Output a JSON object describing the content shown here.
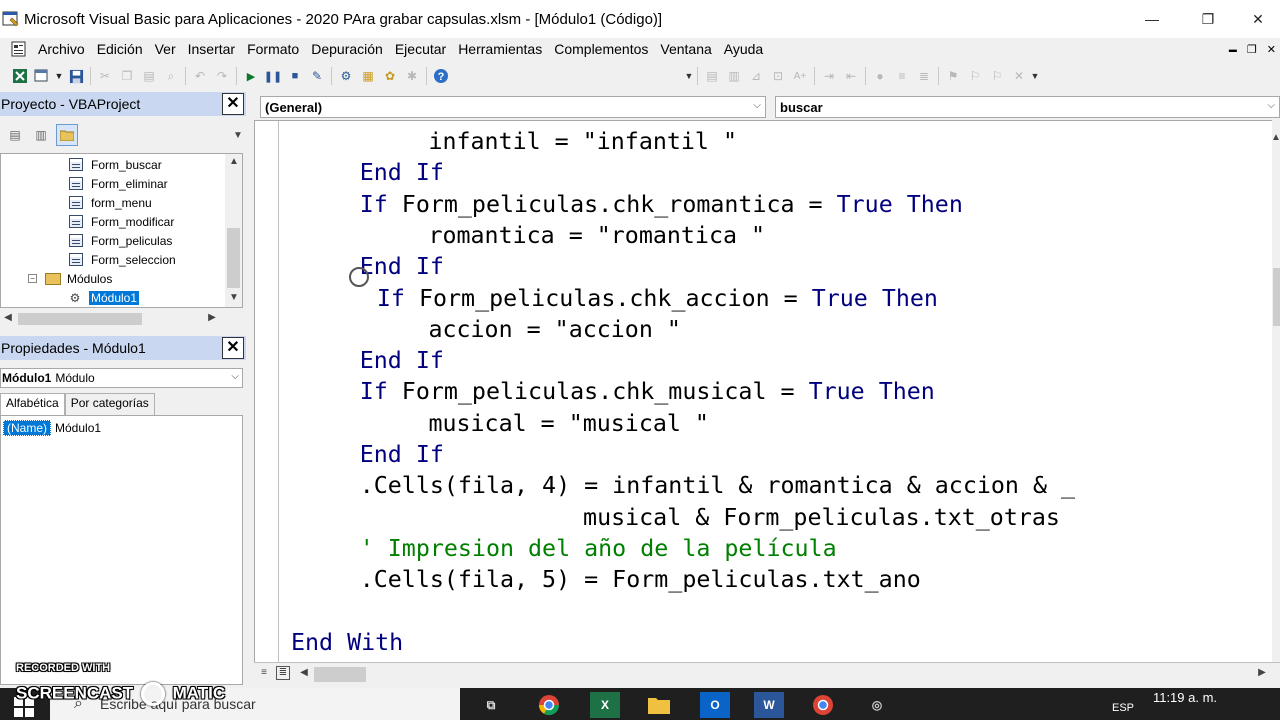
{
  "window": {
    "title": "Microsoft Visual Basic para Aplicaciones - 2020 PAra grabar capsulas.xlsm - [Módulo1 (Código)]",
    "minimize_glyph": "—",
    "restore_glyph": "❐",
    "close_glyph": "✕"
  },
  "menu": {
    "items": [
      "Archivo",
      "Edición",
      "Ver",
      "Insertar",
      "Formato",
      "Depuración",
      "Ejecutar",
      "Herramientas",
      "Complementos",
      "Ventana",
      "Ayuda"
    ],
    "mdi_minimize": "▬",
    "mdi_restore": "❐",
    "mdi_close": "✕"
  },
  "project_pane": {
    "title": "Proyecto - VBAProject",
    "items": [
      {
        "label": "Form_buscar",
        "icon": "form-icon"
      },
      {
        "label": "Form_eliminar",
        "icon": "form-icon"
      },
      {
        "label": "form_menu",
        "icon": "form-icon"
      },
      {
        "label": "Form_modificar",
        "icon": "form-icon"
      },
      {
        "label": "Form_peliculas",
        "icon": "form-icon"
      },
      {
        "label": "Form_seleccion",
        "icon": "form-icon"
      }
    ],
    "modules_folder": "Módulos",
    "selected_module": "Módulo1"
  },
  "properties_pane": {
    "title": "Propiedades - Módulo1",
    "object_name": "Módulo1",
    "object_type": "Módulo",
    "tabs": [
      "Alfabética",
      "Por categorías"
    ],
    "property_name": "(Name)",
    "property_value": "Módulo1"
  },
  "code_window": {
    "object_combo": "(General)",
    "procedure_combo": "buscar",
    "lines": [
      {
        "indent": 8,
        "parts": [
          {
            "t": "infantil = \"infantil \"",
            "c": "plain"
          }
        ]
      },
      {
        "indent": 4,
        "parts": [
          {
            "t": "End If",
            "c": "kw"
          }
        ]
      },
      {
        "indent": 4,
        "parts": [
          {
            "t": "If",
            "c": "kw"
          },
          {
            "t": " Form_peliculas.chk_romantica = ",
            "c": "plain"
          },
          {
            "t": "True Then",
            "c": "kw"
          }
        ]
      },
      {
        "indent": 8,
        "parts": [
          {
            "t": "romantica = \"romantica \"",
            "c": "plain"
          }
        ]
      },
      {
        "indent": 4,
        "parts": [
          {
            "t": "End If",
            "c": "kw"
          }
        ]
      },
      {
        "indent": 5,
        "parts": [
          {
            "t": "If",
            "c": "kw"
          },
          {
            "t": " Form_peliculas.chk_accion = ",
            "c": "plain"
          },
          {
            "t": "True Then",
            "c": "kw"
          }
        ]
      },
      {
        "indent": 8,
        "parts": [
          {
            "t": "accion = \"accion \"",
            "c": "plain"
          }
        ]
      },
      {
        "indent": 4,
        "parts": [
          {
            "t": "End If",
            "c": "kw"
          }
        ]
      },
      {
        "indent": 4,
        "parts": [
          {
            "t": "If",
            "c": "kw"
          },
          {
            "t": " Form_peliculas.chk_musical = ",
            "c": "plain"
          },
          {
            "t": "True Then",
            "c": "kw"
          }
        ]
      },
      {
        "indent": 8,
        "parts": [
          {
            "t": "musical = \"musical \"",
            "c": "plain"
          }
        ]
      },
      {
        "indent": 4,
        "parts": [
          {
            "t": "End If",
            "c": "kw"
          }
        ]
      },
      {
        "indent": 4,
        "parts": [
          {
            "t": ".Cells(fila, 4) = infantil & romantica & accion & _",
            "c": "plain"
          }
        ]
      },
      {
        "indent": 17,
        "parts": [
          {
            "t": "musical & Form_peliculas.txt_otras",
            "c": "plain"
          }
        ]
      },
      {
        "indent": 4,
        "parts": [
          {
            "t": "' Impresion del año de la película",
            "c": "cm"
          }
        ]
      },
      {
        "indent": 4,
        "parts": [
          {
            "t": ".Cells(fila, 5) = Form_peliculas.txt_ano",
            "c": "plain"
          }
        ]
      },
      {
        "indent": 0,
        "parts": []
      },
      {
        "indent": 0,
        "parts": [
          {
            "t": "End With",
            "c": "kw"
          }
        ]
      }
    ]
  },
  "taskbar": {
    "search_placeholder": "Escribe aquí para buscar",
    "time": "11:19 a. m.",
    "language": "ESP"
  },
  "watermark": {
    "line1": "RECORDED WITH",
    "line2": "SCREENCAST",
    "line3": "MATIC"
  }
}
